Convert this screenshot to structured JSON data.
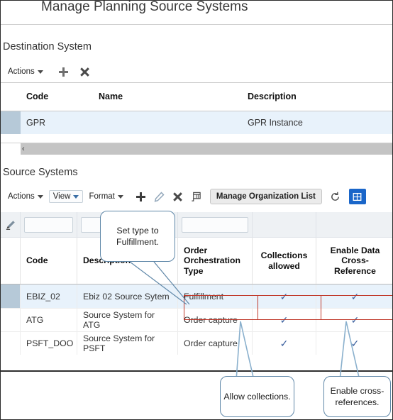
{
  "page": {
    "title": "Manage Planning Source Systems"
  },
  "destination": {
    "section_label": "Destination System",
    "toolbar": {
      "actions_label": "Actions",
      "add_icon": "plus-icon",
      "delete_icon": "close-x-icon"
    },
    "columns": [
      "Code",
      "Name",
      "Description"
    ],
    "rows": [
      {
        "code": "GPR",
        "name": "",
        "description": "GPR Instance"
      }
    ],
    "scroll_arrow": "‹"
  },
  "source": {
    "section_label": "Source Systems",
    "toolbar": {
      "actions_label": "Actions",
      "view_label": "View",
      "format_label": "Format",
      "add_icon": "plus-icon",
      "edit_icon": "pencil-icon",
      "delete_icon": "close-x-icon",
      "detach_icon": "detach-grid-icon",
      "manage_org_label": "Manage Organization List",
      "refresh_icon": "refresh-icon",
      "export_icon": "export-icon"
    },
    "filter_row": {
      "edit_icon": "pen-edit-icon",
      "code_value": "",
      "description_value": "",
      "type_value": ""
    },
    "columns": [
      "Code",
      "Description",
      "Order Orchestration Type",
      "Collections allowed",
      "Enable Data Cross-Reference"
    ],
    "rows": [
      {
        "code": "EBIZ_02",
        "description": "Ebiz 02 Source Sytem",
        "type": "Fulfillment",
        "collections": "✓",
        "xref": "✓",
        "selected": true
      },
      {
        "code": "ATG",
        "description": "Source System for ATG",
        "type": "Order capture",
        "collections": "✓",
        "xref": "✓",
        "selected": false
      },
      {
        "code": "PSFT_DOO",
        "description": "Source System for PSFT",
        "type": "Order capture",
        "collections": "✓",
        "xref": "✓",
        "selected": false
      }
    ]
  },
  "callouts": {
    "set_type": "Set type to Fulfillment.",
    "allow_collections": "Allow collections.",
    "enable_xref": "Enable cross-references."
  },
  "colors": {
    "highlight_border": "#c0392b",
    "callout_border": "#5f87a8",
    "selected_row": "#e8f2fb",
    "row_handle": "#b6c9d8",
    "check_mark": "#3b5f9e",
    "accent_button": "#1a66c9"
  }
}
